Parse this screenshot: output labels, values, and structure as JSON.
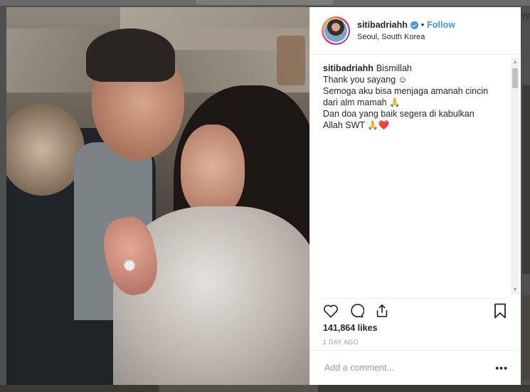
{
  "background": {
    "right_snippet": "yy"
  },
  "post": {
    "username": "sitibadriahh",
    "verified": true,
    "follow_label": "Follow",
    "separator": "•",
    "location": "Seoul, South Korea",
    "caption_user": "sitibadriahh",
    "caption_lines": [
      "Bismillah",
      "Thank you sayang ☺",
      "Semoga aku bisa menjaga amanah cincin",
      "dari alm mamah 🙏",
      "Dan doa yang baik segera di kabulkan",
      "Allah SWT 🙏❤️"
    ],
    "likes": "141,864 likes",
    "time_ago": "1 DAY AGO",
    "comment_placeholder": "Add a comment...",
    "more_label": "•••"
  },
  "icons": {
    "like": "heart-icon",
    "comment": "comment-icon",
    "share": "share-icon",
    "save": "bookmark-icon"
  },
  "colors": {
    "accent": "#3897f0",
    "text": "#262626",
    "muted": "#999999"
  }
}
